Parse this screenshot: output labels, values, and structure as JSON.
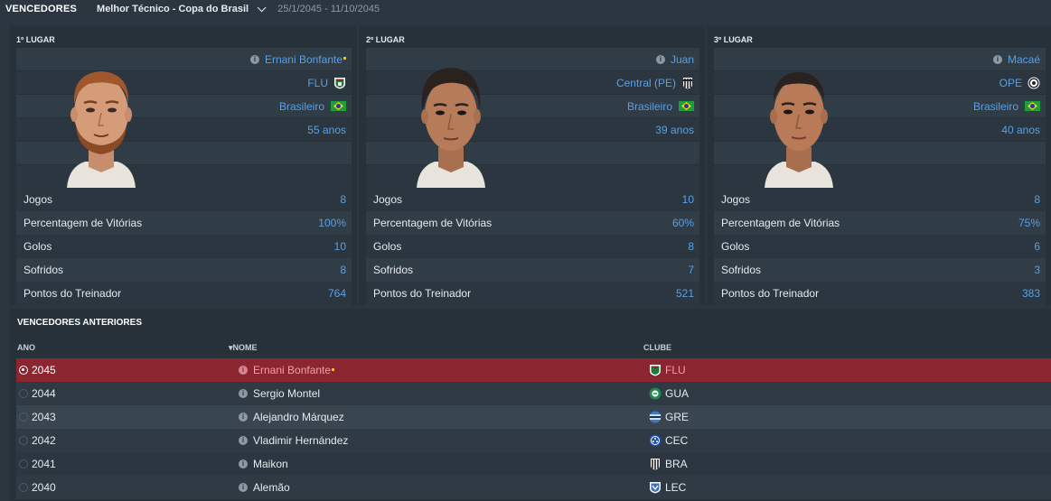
{
  "header": {
    "title": "VENCEDORES",
    "award": "Melhor Técnico - Copa do Brasil",
    "dates": "25/1/2045 - 11/10/2045"
  },
  "podium": [
    {
      "place": "1º LUGAR",
      "name": "Ernani Bonfante",
      "club": "FLU",
      "nationality": "Brasileiro",
      "age": "55 anos",
      "stats": [
        {
          "label": "Jogos",
          "value": "8"
        },
        {
          "label": "Percentagem de Vitórias",
          "value": "100%"
        },
        {
          "label": "Golos",
          "value": "10"
        },
        {
          "label": "Sofridos",
          "value": "8"
        },
        {
          "label": "Pontos do Treinador",
          "value": "764"
        }
      ]
    },
    {
      "place": "2º LUGAR",
      "name": "Juan",
      "club": "Central (PE)",
      "nationality": "Brasileiro",
      "age": "39 anos",
      "stats": [
        {
          "label": "Jogos",
          "value": "10"
        },
        {
          "label": "Percentagem de Vitórias",
          "value": "60%"
        },
        {
          "label": "Golos",
          "value": "8"
        },
        {
          "label": "Sofridos",
          "value": "7"
        },
        {
          "label": "Pontos do Treinador",
          "value": "521"
        }
      ]
    },
    {
      "place": "3º LUGAR",
      "name": "Macaé",
      "club": "OPE",
      "nationality": "Brasileiro",
      "age": "40 anos",
      "stats": [
        {
          "label": "Jogos",
          "value": "8"
        },
        {
          "label": "Percentagem de Vitórias",
          "value": "75%"
        },
        {
          "label": "Golos",
          "value": "6"
        },
        {
          "label": "Sofridos",
          "value": "3"
        },
        {
          "label": "Pontos do Treinador",
          "value": "383"
        }
      ]
    }
  ],
  "history": {
    "title": "VENCEDORES ANTERIORES",
    "columns": {
      "year": "ANO",
      "name": "▾NOME",
      "club": "CLUBE"
    },
    "rows": [
      {
        "year": "2045",
        "name": "Ernani Bonfante",
        "club": "FLU"
      },
      {
        "year": "2044",
        "name": "Sergio Montel",
        "club": "GUA"
      },
      {
        "year": "2043",
        "name": "Alejandro Márquez",
        "club": "GRE"
      },
      {
        "year": "2042",
        "name": "Vladimir Hernández",
        "club": "CEC"
      },
      {
        "year": "2041",
        "name": "Maikon",
        "club": "BRA"
      },
      {
        "year": "2040",
        "name": "Alemão",
        "club": "LEC"
      }
    ]
  },
  "colors": {
    "background": "#2b3640",
    "panel": "#26313a",
    "link_blue": "#5aa0e2",
    "selected_row": "#8b2530"
  }
}
